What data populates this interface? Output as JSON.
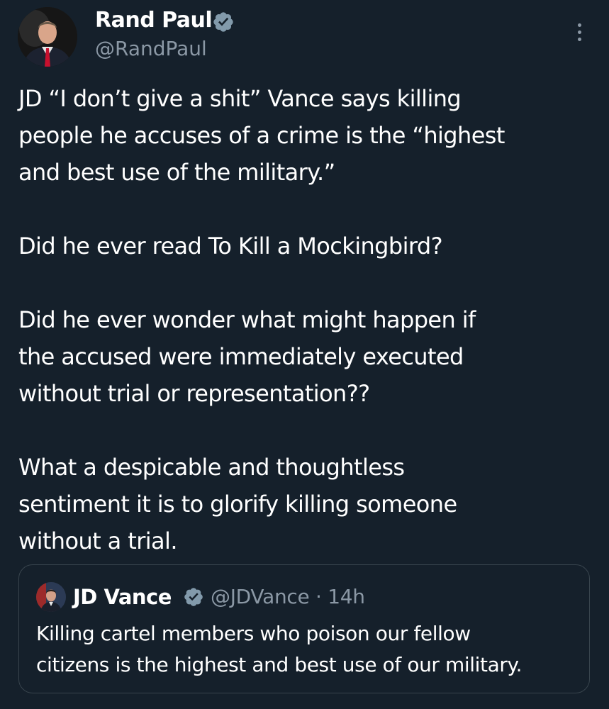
{
  "tweet": {
    "author": {
      "name": "Rand Paul",
      "handle": "@RandPaul",
      "verified": true
    },
    "text_lines": [
      "JD “I don’t give a shit” Vance says killing",
      "people he accuses of a crime is the “highest",
      "and best use of the military.”",
      "",
      "Did he ever read To Kill a Mockingbird?",
      "",
      "Did he ever wonder what might happen if",
      "the accused were immediately executed",
      "without trial or representation??",
      "",
      "What a despicable and thoughtless",
      "sentiment it is to glorify killing someone",
      "without a trial."
    ],
    "quoted_tweet": {
      "author_name": "JD Vance",
      "handle": "@JDVance",
      "separator": " · ",
      "time": "14h",
      "verified": true,
      "text_lines": [
        "Killing cartel members who poison our fellow",
        "citizens is the highest and best use of our military."
      ]
    }
  },
  "colors": {
    "background": "#15202b",
    "text_primary": "#ffffff",
    "text_secondary": "#8b98a5",
    "verified_badge": "#829aab",
    "card_border": "#38444d"
  },
  "icons": {
    "verified": "verified-badge-icon",
    "more": "more-options-icon"
  }
}
